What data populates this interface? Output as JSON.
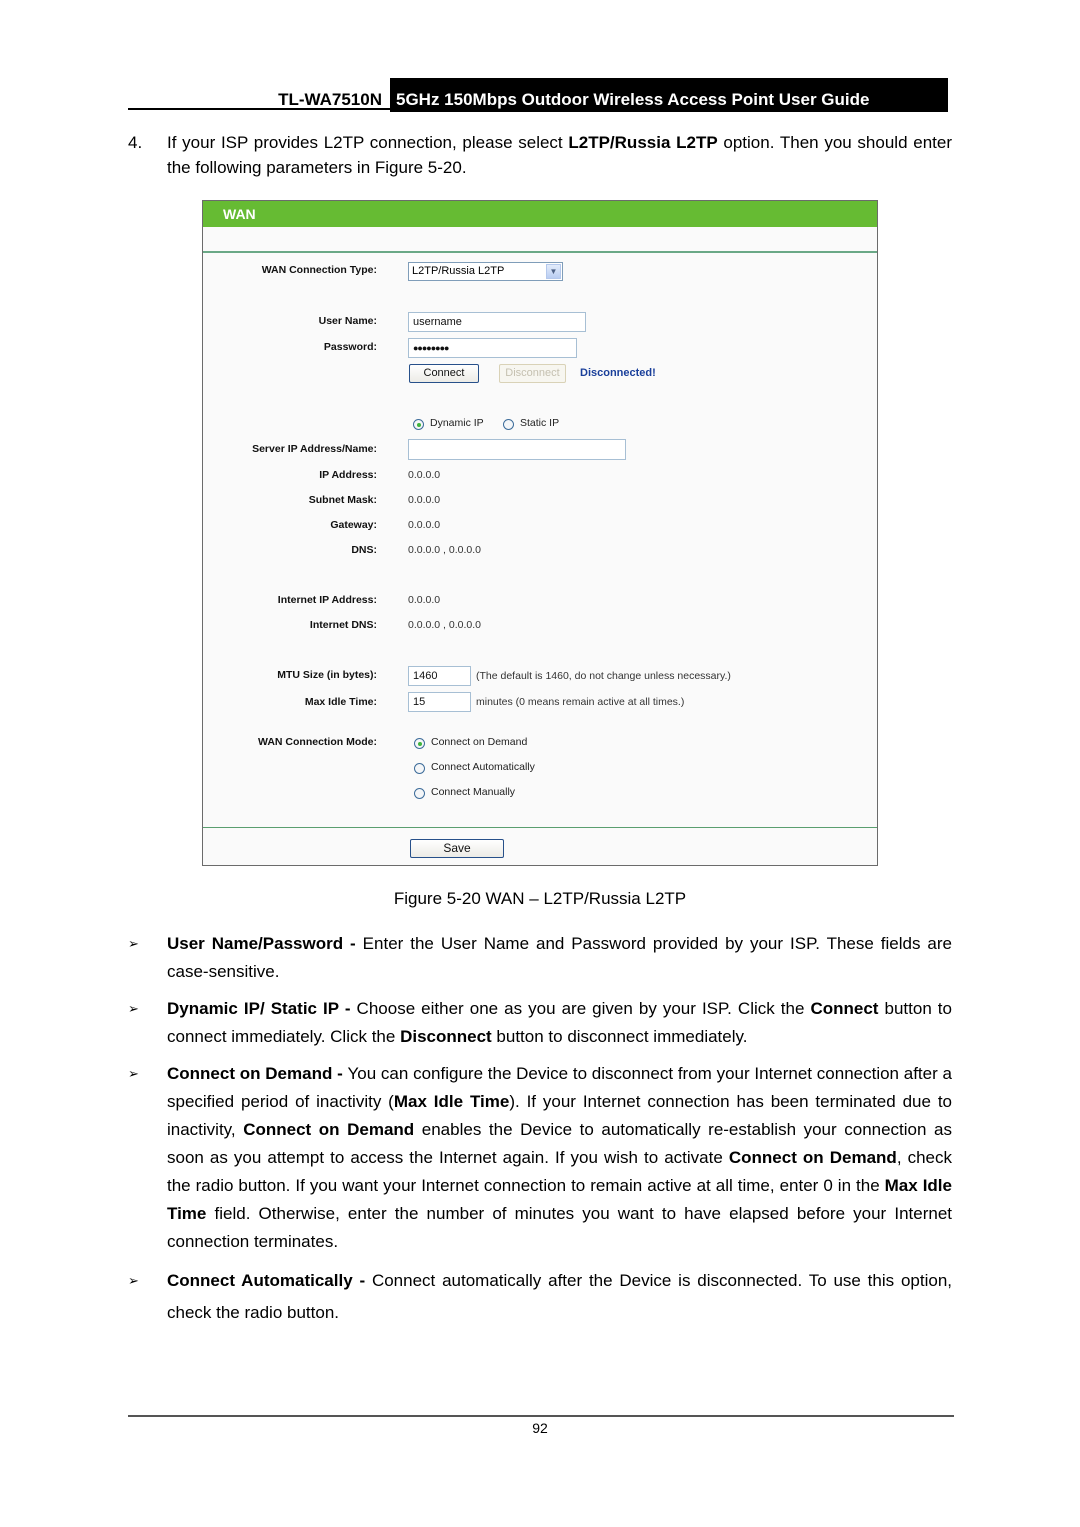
{
  "header": {
    "model": "TL-WA7510N",
    "title": "5GHz 150Mbps Outdoor Wireless Access Point User Guide"
  },
  "step": {
    "number": "4.",
    "text_1": "If your ISP provides L2TP connection, please select ",
    "bold_1": "L2TP/Russia L2TP",
    "text_2": " option. Then you should enter the following parameters in Figure 5-20."
  },
  "figure": {
    "panel_title": "WAN",
    "wan_connection_type": {
      "label": "WAN Connection Type:",
      "value": "L2TP/Russia L2TP"
    },
    "user_name": {
      "label": "User Name:",
      "value": "username"
    },
    "password": {
      "label": "Password:",
      "value": "●●●●●●●●"
    },
    "connect_button": "Connect",
    "disconnect_button": "Disconnect",
    "connection_status": "Disconnected!",
    "ip_mode": {
      "options": [
        {
          "label": "Dynamic IP",
          "selected": true
        },
        {
          "label": "Static IP",
          "selected": false
        }
      ]
    },
    "server": {
      "label": "Server IP Address/Name:",
      "value": ""
    },
    "ip_address": {
      "label": "IP Address:",
      "value": "0.0.0.0"
    },
    "subnet_mask": {
      "label": "Subnet Mask:",
      "value": "0.0.0.0"
    },
    "gateway": {
      "label": "Gateway:",
      "value": "0.0.0.0"
    },
    "dns": {
      "label": "DNS:",
      "value": "0.0.0.0 , 0.0.0.0"
    },
    "internet_ip": {
      "label": "Internet IP Address:",
      "value": "0.0.0.0"
    },
    "internet_dns": {
      "label": "Internet DNS:",
      "value": "0.0.0.0 , 0.0.0.0"
    },
    "mtu": {
      "label": "MTU Size (in bytes):",
      "value": "1460",
      "hint": "(The default is 1460, do not change unless necessary.)"
    },
    "max_idle": {
      "label": "Max Idle Time:",
      "value": "15",
      "hint": "minutes (0 means remain active at all times.)"
    },
    "connection_mode": {
      "label": "WAN Connection Mode:",
      "options": [
        {
          "label": "Connect on Demand",
          "selected": true
        },
        {
          "label": "Connect Automatically",
          "selected": false
        },
        {
          "label": "Connect Manually",
          "selected": false
        }
      ]
    },
    "save_button": "Save",
    "caption": "Figure 5-20 WAN – L2TP/Russia L2TP"
  },
  "bullets": [
    {
      "bold": "User Name/Password - ",
      "text": "Enter the User Name and Password provided by your ISP. These fields are case-sensitive."
    },
    {
      "bold": "Dynamic IP/ Static IP - ",
      "text_1": "Choose either one as you are given by your ISP. Click the ",
      "bold_1": "Connect",
      "text_2": " button to connect immediately. Click the ",
      "bold_2": "Disconnect",
      "text_3": " button to disconnect immediately."
    },
    {
      "bold": "Connect on Demand - ",
      "text_1": "You can configure the Device to disconnect from your Internet connection after a specified period of inactivity (",
      "bold_1": "Max Idle Time",
      "text_2": "). If your Internet connection has been terminated due to inactivity, ",
      "bold_2": "Connect on Demand",
      "text_3": " enables the Device to automatically re-establish your connection as soon as you attempt to access the Internet again. If you wish to activate ",
      "bold_3": "Connect on Demand",
      "text_4": ", check the radio button. If you want your Internet connection to remain active at all time, enter 0 in the ",
      "bold_4": "Max Idle Time",
      "text_5": " field. Otherwise, enter the number of minutes you want to have elapsed before your Internet connection terminates."
    },
    {
      "bold": "Connect Automatically - ",
      "text": "Connect automatically after the Device is disconnected. To use this option, check the radio button."
    }
  ],
  "bullet_marker": "➢",
  "footer": {
    "page_number": "92"
  }
}
